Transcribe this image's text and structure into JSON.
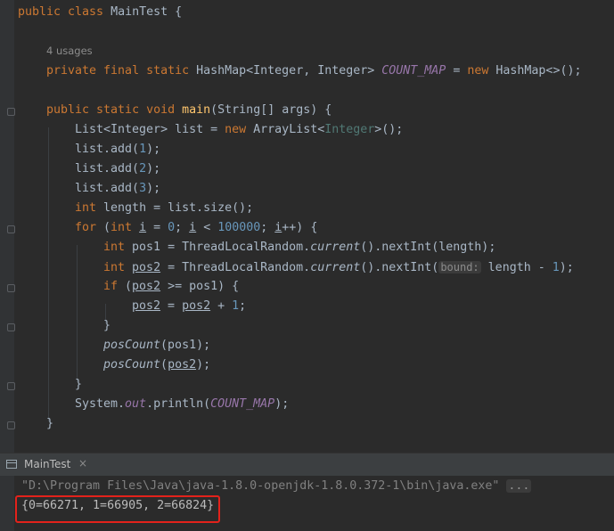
{
  "editor": {
    "lines": {
      "l1": {
        "kw": "public class",
        "rest": " MainTest {"
      },
      "usages": "4 usages",
      "l3": {
        "kw1": "private final static",
        "t1": " HashMap<Integer, Integer> ",
        "f": "COUNT_MAP",
        "t2": " = ",
        "kw2": "new",
        "t3": " HashMap<>();"
      },
      "l5": {
        "kw": "public static void",
        "sp": " ",
        "fn": "main",
        "rest": "(String[] args) {"
      },
      "l6": {
        "t1": "List<Integer> list = ",
        "kw": "new",
        "t2": " ArrayList<",
        "g": "Integer",
        "t3": ">();"
      },
      "l7": {
        "t1": "list.add(",
        "n": "1",
        "t2": ");"
      },
      "l8": {
        "t1": "list.add(",
        "n": "2",
        "t2": ");"
      },
      "l9": {
        "t1": "list.add(",
        "n": "3",
        "t2": ");"
      },
      "l10": {
        "kw": "int",
        "rest": " length = list.size();"
      },
      "l11": {
        "kw1": "for",
        "t1": " (",
        "kw2": "int",
        "sp": " ",
        "v1": "i",
        "t2": " = ",
        "n1": "0",
        "t3": "; ",
        "v2": "i",
        "t4": " < ",
        "n2": "100000",
        "t5": "; ",
        "v3": "i",
        "t6": "++) {"
      },
      "l12": {
        "kw": "int",
        "t1": " pos1 = ThreadLocalRandom.",
        "it": "current",
        "t2": "().nextInt(length);"
      },
      "l13": {
        "kw": "int",
        "sp": " ",
        "v": "pos2",
        "t1": " = ThreadLocalRandom.",
        "it": "current",
        "t2": "().nextInt(",
        "hint": "bound:",
        "t3": " length - ",
        "n": "1",
        "t4": ");"
      },
      "l14": {
        "kw": "if",
        "t1": " (",
        "v": "pos2",
        "t2": " >= pos1) {"
      },
      "l15": {
        "v1": "pos2",
        "t1": " = ",
        "v2": "pos2",
        "t2": " + ",
        "n": "1",
        "t3": ";"
      },
      "l16": "}",
      "l17": {
        "it": "posCount",
        "rest": "(pos1);"
      },
      "l18": {
        "it": "posCount",
        "t1": "(",
        "v": "pos2",
        "t2": ");"
      },
      "l19": "}",
      "l20": {
        "t1": "System.",
        "f1": "out",
        "t2": ".println(",
        "f2": "COUNT_MAP",
        "t3": ");"
      },
      "l21": "}"
    }
  },
  "run_panel": {
    "tab_label": "MainTest",
    "close": "×",
    "command": "\"D:\\Program Files\\Java\\java-1.8.0-openjdk-1.8.0.372-1\\bin\\java.exe\"",
    "ellipsis": "...",
    "output": "{0=66271, 1=66905, 2=66824}"
  },
  "colors": {
    "background": "#2b2b2b",
    "keyword": "#cc7832",
    "number": "#6897bb",
    "method": "#ffc66d",
    "static_field": "#9876aa",
    "highlight_box": "#e3221b"
  }
}
